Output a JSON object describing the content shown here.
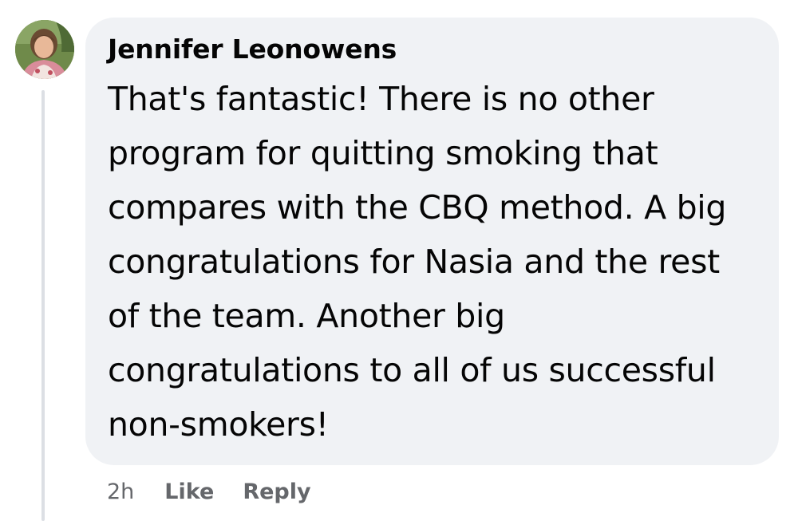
{
  "comment": {
    "author": "Jennifer Leonowens",
    "text": "That's fantastic! There is no other program for quitting smoking that compares with the CBQ method. A big congratulations for Nasia and the rest of the team. Another big congratulations to all of us successful non-smokers!",
    "timestamp": "2h",
    "like_label": "Like",
    "reply_label": "Reply"
  },
  "colors": {
    "bubble_background": "#f0f2f5",
    "text": "#050505",
    "secondary_text": "#65676b",
    "thread_line": "#dcdfe4"
  },
  "icons": {
    "avatar": "profile-photo"
  }
}
